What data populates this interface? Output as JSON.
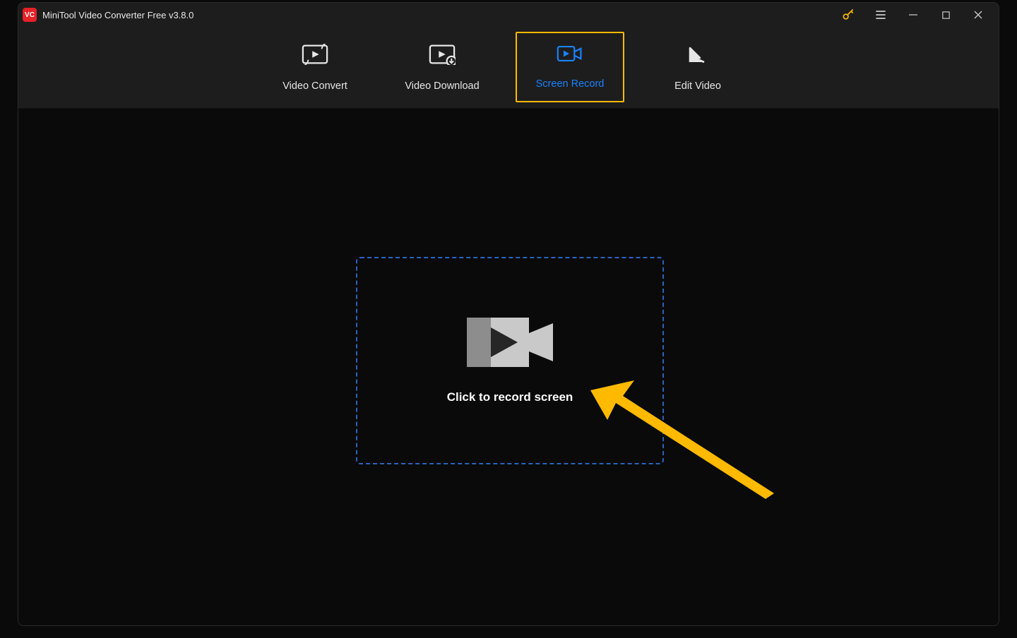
{
  "titlebar": {
    "app_short": "VC",
    "title": "MiniTool Video Converter Free v3.8.0",
    "icons": {
      "key": "key-icon",
      "menu": "hamburger-menu-icon",
      "min": "minimize-icon",
      "max": "maximize-icon",
      "close": "close-icon"
    }
  },
  "tabs": {
    "convert": "Video Convert",
    "download": "Video Download",
    "record": "Screen Record",
    "edit": "Edit Video",
    "active": "record"
  },
  "main": {
    "drop_label": "Click to record screen"
  },
  "annotation": {
    "arrow_color": "#ffba00"
  }
}
